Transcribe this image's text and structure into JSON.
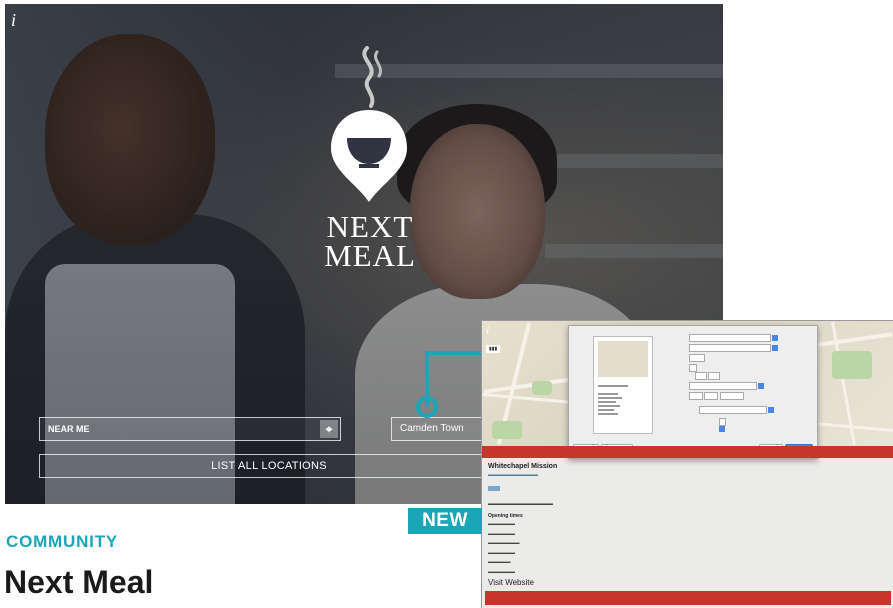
{
  "hero": {
    "info_icon": "i",
    "brand_line1": "NEXT",
    "brand_line2": "MEAL",
    "near_me_label": "NEAR ME",
    "location_icon": "crosshair-icon",
    "area_value": "Camden Town",
    "list_all_label": "LIST ALL LOCATIONS"
  },
  "detail_screen": {
    "info_icon": "i",
    "venue_name": "Whitechapel Mission",
    "visit_website": "Visit Website",
    "opening_times_label": "Opening times"
  },
  "badge": "NEW",
  "article": {
    "category": "COMMUNITY",
    "title": "Next Meal"
  },
  "colors": {
    "accent": "#1aa6b7",
    "red": "#c8352b"
  }
}
